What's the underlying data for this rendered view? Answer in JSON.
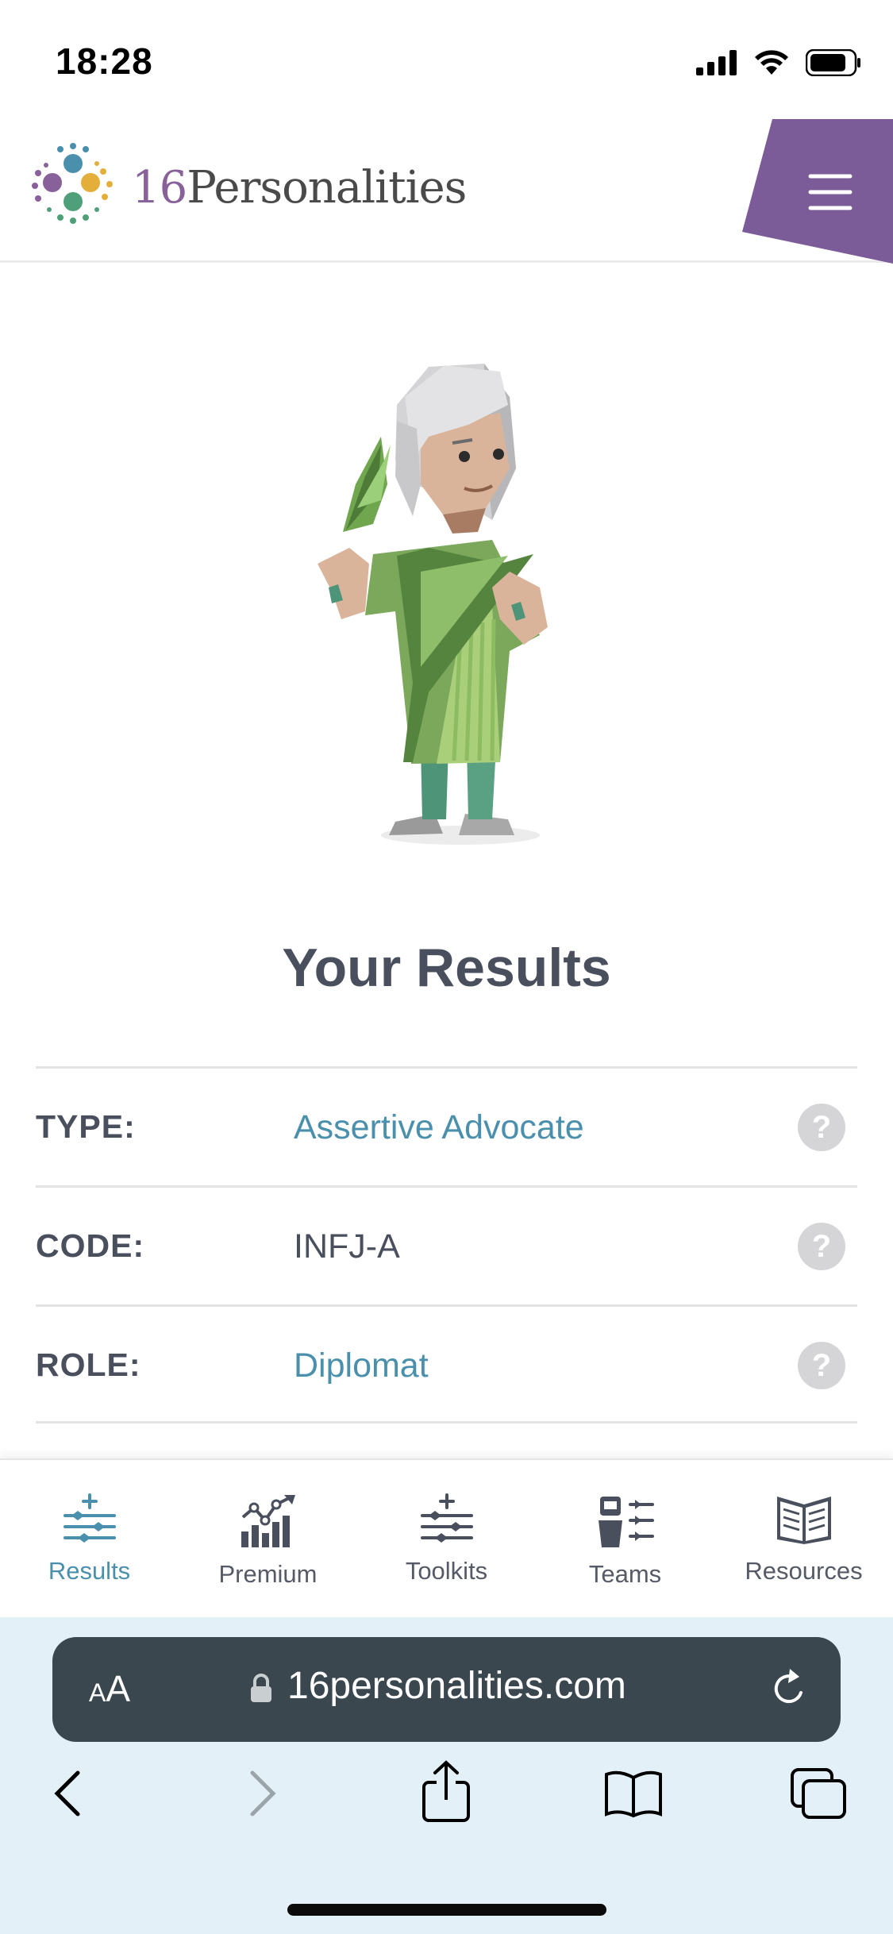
{
  "status_bar": {
    "time": "18:28"
  },
  "header": {
    "logo_number": "16",
    "logo_word": "Personalities"
  },
  "main": {
    "title": "Your Results",
    "rows": [
      {
        "label": "TYPE:",
        "value": "Assertive Advocate"
      },
      {
        "label": "CODE:",
        "value": "INFJ-A"
      },
      {
        "label": "ROLE:",
        "value": "Diplomat"
      }
    ],
    "help_glyph": "?"
  },
  "bottom_nav": {
    "items": [
      {
        "label": "Results",
        "icon": "sliders-plus-icon",
        "active": true
      },
      {
        "label": "Premium",
        "icon": "chart-icon",
        "active": false
      },
      {
        "label": "Toolkits",
        "icon": "sliders-plus-icon",
        "active": false
      },
      {
        "label": "Teams",
        "icon": "team-icon",
        "active": false
      },
      {
        "label": "Resources",
        "icon": "book-icon",
        "active": false
      }
    ]
  },
  "safari": {
    "aa_small": "A",
    "aa_large": "A",
    "url": "16personalities.com"
  },
  "colors": {
    "brand_purple": "#7b5c98",
    "link_blue": "#4a8fac",
    "text_dark": "#4a4f5e"
  }
}
